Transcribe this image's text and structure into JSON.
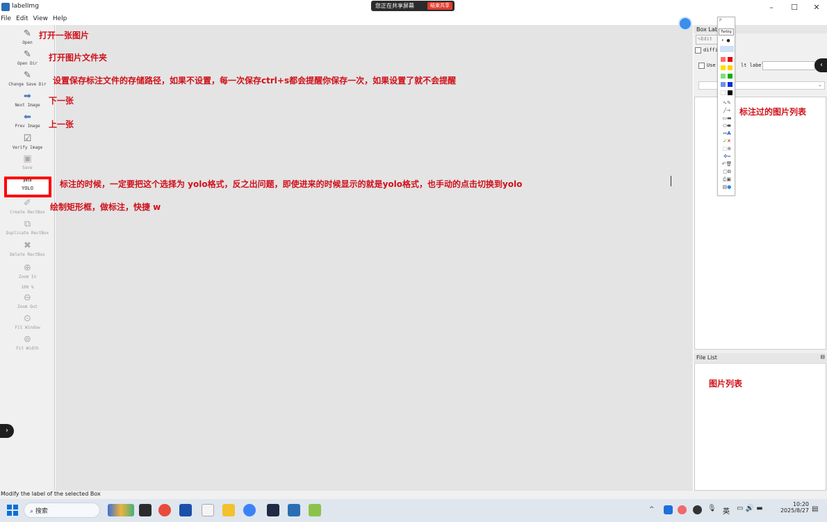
{
  "window": {
    "title": "labelImg",
    "minimize": "–",
    "maximize": "☐",
    "close": "✕"
  },
  "share_bar": {
    "text": "您正在共享屏幕",
    "stop_label": "结束共享"
  },
  "menu": [
    "File",
    "Edit",
    "View",
    "Help"
  ],
  "toolbar": {
    "open": "Open",
    "open_dir": "Open Dir",
    "change_save_dir": "Change Save Dir",
    "next_image": "Next Image",
    "prev_image": "Prev Image",
    "verify_image": "Verify Image",
    "save": "Save",
    "format_small": "yolo",
    "format": "YOLO",
    "create_rectbox": "Create RectBox",
    "duplicate_rectbox": "Duplicate RectBox",
    "delete_rectbox": "Delete RectBox",
    "zoom_in": "Zoom In",
    "zoom_level": "100 %",
    "zoom_out": "Zoom Out",
    "fit_window": "Fit Window",
    "fit_width": "Fit Width"
  },
  "annotations": {
    "open": "打开一张图片",
    "open_dir": "打开图片文件夹",
    "change_save_dir": "设置保存标注文件的存储路径，如果不设置，每一次保存ctrl+s都会提醒你保存一次，如果设置了就不会提醒",
    "next": "下一张",
    "prev": "上一张",
    "format": "标注的时候，一定要把这个选择为 yolo格式，反之出问题，即使进来的时候显示的就是yolo格式，也手动的点击切换到yolo",
    "create": "绘制矩形框，做标注，快捷 w",
    "labeled_list": "标注过的图片列表",
    "file_list": "图片列表"
  },
  "right_panel": {
    "box_labels_title": "Box Lab",
    "edit_label": "Edit",
    "difficult": "diffi",
    "use_default_prefix": "Use",
    "use_default_suffix": "lt label",
    "file_list_title": "File List",
    "float_icon": "⊟"
  },
  "palette": {
    "title": "P",
    "tooltip": "Farbig"
  },
  "statusbar": {
    "text": "Modify the label of the selected Box"
  },
  "taskbar": {
    "search": "搜索",
    "ime": "英",
    "time": "10:20",
    "date": "2025/8/27"
  },
  "colors": {
    "annotation": "#d0101a",
    "highlight": "#ff0000",
    "canvas": "#e4e4e4",
    "toolbar": "#f0f0f0"
  }
}
